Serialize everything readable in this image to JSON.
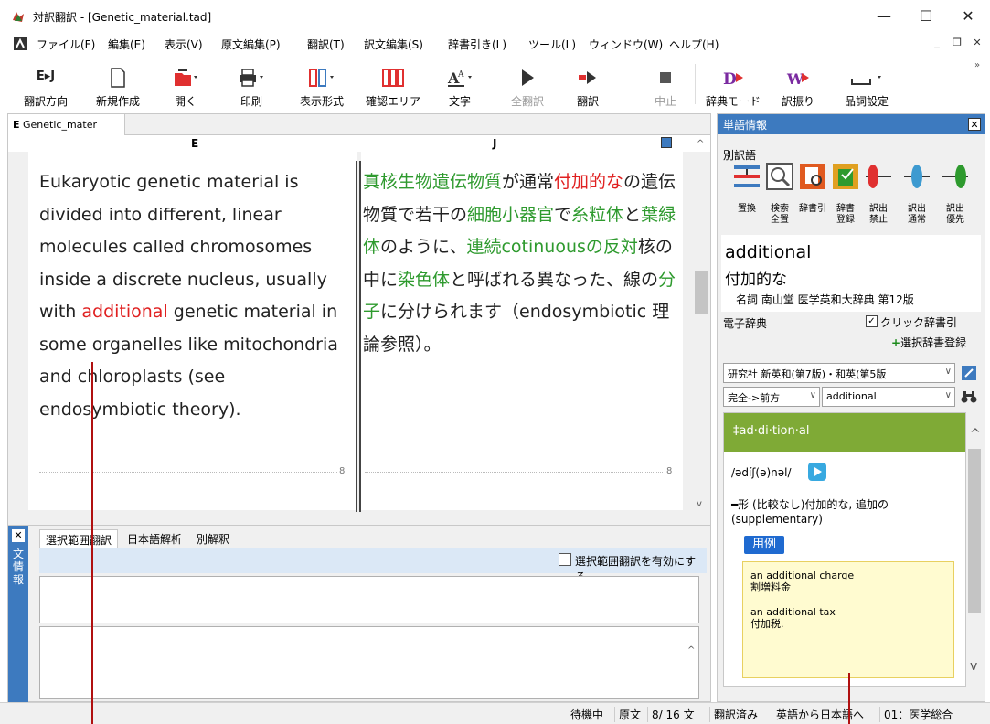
{
  "window": {
    "title": "対訳翻訳 - [Genetic_material.tad]",
    "minimize": "—",
    "maximize": "☐",
    "close": "✕"
  },
  "menu": [
    "ファイル(F)",
    "編集(E)",
    "表示(V)",
    "原文編集(P)",
    "翻訳(T)",
    "訳文編集(S)",
    "辞書引き(L)",
    "ツール(L)",
    "ウィンドウ(W)",
    "ヘルプ(H)"
  ],
  "toolbar": {
    "direction": "翻訳方向",
    "direction_icon": "E▸J",
    "new": "新規作成",
    "open": "開く",
    "print": "印刷",
    "layout": "表示形式",
    "confirm_area": "確認エリア",
    "font": "文字",
    "translate_all": "全翻訳",
    "translate": "翻訳",
    "stop": "中止",
    "dict_mode": "辞典モード",
    "word_assign": "訳振り",
    "pos_setting": "品詞設定"
  },
  "document": {
    "tab_label": "Genetic_mater",
    "tab_icon": "E",
    "col_e": "E",
    "col_j": "J",
    "en_before": "Eukaryotic genetic material is divided into different, linear molecules called chromosomes inside a discrete nucleus, usually with ",
    "en_highlight": "additional",
    "en_after": " genetic material in some organelles like mitochondria and chloroplasts (see endosymbiotic theory).",
    "ja_segments": [
      {
        "t": "真核生物遺伝物質",
        "c": "grn"
      },
      {
        "t": "が通常",
        "c": ""
      },
      {
        "t": "付加的な",
        "c": "red"
      },
      {
        "t": "の遺伝物質で若干の",
        "c": ""
      },
      {
        "t": "細胞小器官",
        "c": "grn"
      },
      {
        "t": "で",
        "c": ""
      },
      {
        "t": "糸粒体",
        "c": "grn"
      },
      {
        "t": "と",
        "c": ""
      },
      {
        "t": "葉緑体",
        "c": "grn"
      },
      {
        "t": "のように、",
        "c": ""
      },
      {
        "t": "連続cotinuousの反対",
        "c": "grn"
      },
      {
        "t": "核の中に",
        "c": ""
      },
      {
        "t": "染色体",
        "c": "grn"
      },
      {
        "t": "と呼ばれる異なった、線の",
        "c": ""
      },
      {
        "t": "分子",
        "c": "grn"
      },
      {
        "t": "に分けられます（endosymbiotic 理論参照）。",
        "c": ""
      }
    ],
    "sentence_no_left": "8",
    "sentence_no_right": "8"
  },
  "bottom_panel": {
    "side_label": "文情報",
    "tabs": [
      "選択範囲翻訳",
      "日本語解析",
      "別解釈"
    ],
    "enable_label": "選択範囲翻訳を有効にする"
  },
  "word_info": {
    "title": "単語情報",
    "alt_label": "別訳語",
    "buttons": [
      {
        "l1": "置換",
        "l2": ""
      },
      {
        "l1": "検索",
        "l2": "全置"
      },
      {
        "l1": "辞書引",
        "l2": ""
      },
      {
        "l1": "辞書",
        "l2": "登録"
      },
      {
        "l1": "訳出",
        "l2": "禁止"
      },
      {
        "l1": "訳出",
        "l2": "通常"
      },
      {
        "l1": "訳出",
        "l2": "優先"
      }
    ],
    "word": "additional",
    "translation": "付加的な",
    "source": "名詞 南山堂 医学英和大辞典 第12版"
  },
  "dictionary": {
    "label": "電子辞典",
    "click_lookup": "クリック辞書引",
    "register": "選択辞書登録",
    "dict_select": "研究社 新英和(第7版)・和英(第5版",
    "match_mode": "完全->前方",
    "query": "additional",
    "headword": "‡ad·di·tion·al",
    "pron": "/ədíʃ(ə)nəl/",
    "def": "━形 (比較なし)付加的な, 追加の(supplementary)",
    "example_label": "用例",
    "ex1_en": "an additional charge",
    "ex1_ja": "割増料金",
    "ex2_en": "an additional tax",
    "ex2_ja": "付加税."
  },
  "status": {
    "state": "待機中",
    "mode": "原文",
    "sentence": "8/ 16 文",
    "translated": "翻訳済み",
    "direction": "英語から日本語へ",
    "field": "01：医学総合"
  },
  "colors": {
    "accent": "#3d7abf",
    "highlight_red": "#e02020",
    "term_green": "#2e9a2e",
    "dict_header": "#7faa36"
  }
}
